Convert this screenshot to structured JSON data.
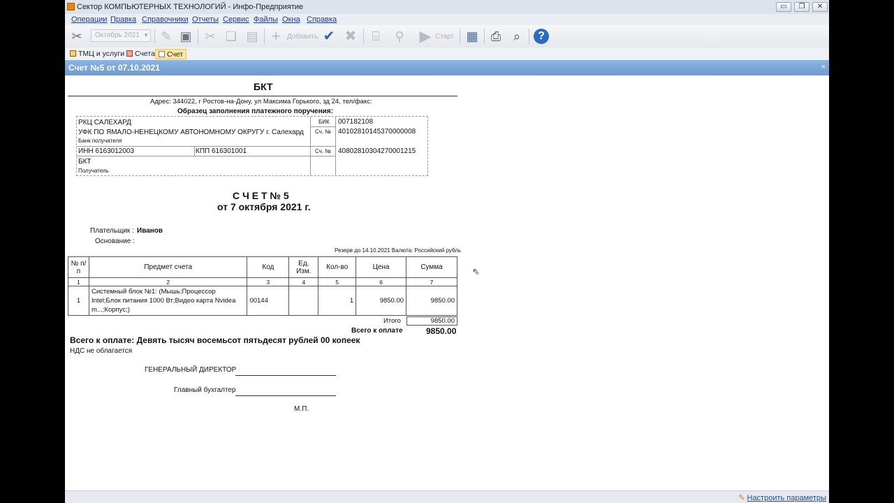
{
  "window": {
    "title": "Сектор КОМПЬЮТЕРНЫХ ТЕХНОЛОГИЙ - Инфо-Предприятие",
    "controls": [
      "▭",
      "❐",
      "✕"
    ]
  },
  "menu": [
    "Операции",
    "Правка",
    "Справочники",
    "Отчеты",
    "Сервис",
    "Файлы",
    "Окна",
    "Справка"
  ],
  "toolbar": {
    "period_value": "Октябрь 2021",
    "add_label": "Добавить",
    "start_label": "Старт"
  },
  "tabs": [
    {
      "label": "ТМЦ и услуги",
      "active": false
    },
    {
      "label": "Счета",
      "active": false
    },
    {
      "label": "Счет",
      "active": true
    }
  ],
  "document": {
    "title": "Счет №5 от 07.10.2021",
    "close": "×"
  },
  "invoice": {
    "company": "БКТ",
    "address": "Адрес: 344022, г Ростов-на-Дону, ул Максима Горького, зд 24, тел/факс:",
    "sample_caption": "Образец заполнения платежного поручения:",
    "bank": {
      "line1": "РКЦ САЛЕХАРД",
      "line2": "УФК  ПО ЯМАЛО-НЕНЕЦКОМУ АВТОНОМНОМУ ОКРУГУ г. Салехард",
      "bank_caption": "Банк получателя",
      "bik_label": "БИК",
      "bik_value": "007182108",
      "acc_label": "Сч. №",
      "acc_value": "40102810145370000008",
      "inn": "ИНН 6163012003",
      "kpp": "КПП 616301001",
      "acc2_label": "Сч. №",
      "acc2_value": "40802810304270001215",
      "recipient": "БКТ",
      "recipient_caption": "Получатель"
    },
    "heading": "С Ч Е Т  № 5",
    "date_line": "от  7 октября 2021 г.",
    "payer_label": "Плательщик :",
    "payer_value": "Иванов",
    "basis_label": "Основание :",
    "reserve_note": "Резерв до 14.10.2021 Валюта: Российский рубль",
    "columns": [
      "№ п/п",
      "Предмет   счета",
      "Код",
      "Ед. Изм.",
      "Кол-во",
      "Цена",
      "Сумма"
    ],
    "column_numbers": [
      "1",
      "2",
      "3",
      "4",
      "5",
      "6",
      "7"
    ],
    "rows": [
      {
        "num": "1",
        "name": "Системный блок №1: (Мышь;Процессор Intel;Блок питания 1000 Вт;Видео карта Nvidea m...;Корпус;)",
        "code": "00144",
        "unit": "",
        "qty": "1",
        "price": "9850.00",
        "sum": "9850.00"
      }
    ],
    "total_label": "Итого",
    "total_value": "9850.00",
    "grand_total_label": "Всего к оплате",
    "grand_total_value": "9850.00",
    "amount_words": "Всего к оплате: Девять тысяч восемьсот пятьдесят рублей 00 копеек",
    "vat_note": "НДС не облагается",
    "director_label": "ГЕНЕРАЛЬНЫЙ ДИРЕКТОР",
    "accountant_label": "Главный бухгалтер",
    "stamp": "М.П."
  },
  "status": {
    "settings_link": "Настроить параметры"
  }
}
